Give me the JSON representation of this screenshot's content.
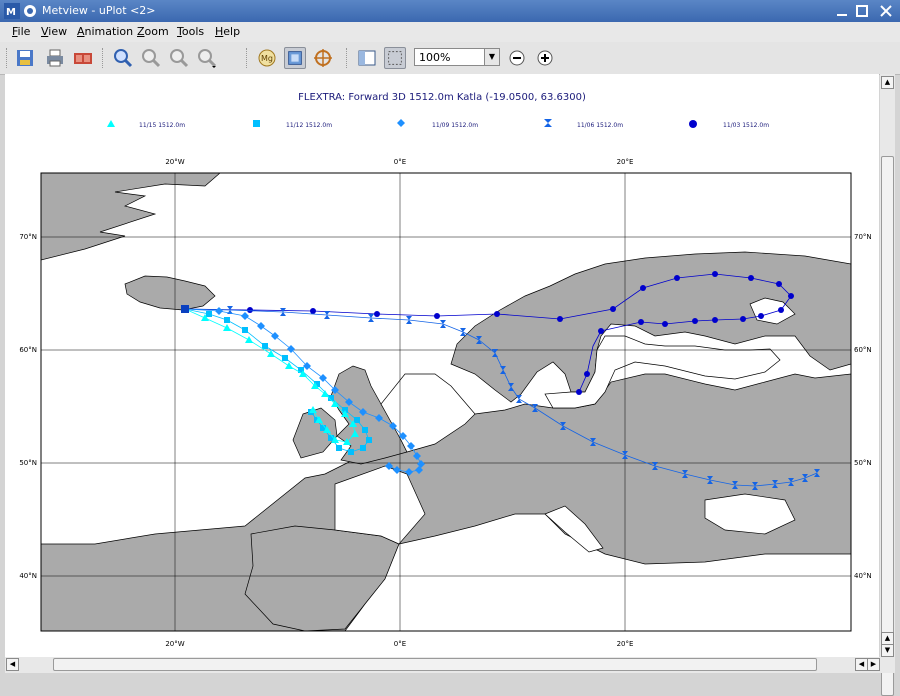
{
  "window": {
    "title": "Metview - uPlot <2>"
  },
  "menu": [
    {
      "label": "File",
      "key": "F",
      "rest": "ile"
    },
    {
      "label": "View",
      "key": "V",
      "rest": "iew"
    },
    {
      "label": "Animation",
      "key": "A",
      "rest": "nimation"
    },
    {
      "label": "Zoom",
      "key": "Z",
      "rest": "oom"
    },
    {
      "label": "Tools",
      "key": "T",
      "rest": "ools"
    },
    {
      "label": "Help",
      "key": "H",
      "rest": "elp"
    }
  ],
  "toolbar": {
    "zoom_value": "100%"
  },
  "plot": {
    "title": "FLEXTRA: Forward 3D 1512.0m Katla (-19.0500, 63.6300)",
    "legend": [
      {
        "label": "11/15 1512.0m",
        "marker": "triangle",
        "color": "#00ffff"
      },
      {
        "label": "11/12 1512.0m",
        "marker": "square",
        "color": "#00bfff"
      },
      {
        "label": "11/09 1512.0m",
        "marker": "diamond",
        "color": "#1e90ff"
      },
      {
        "label": "11/06 1512.0m",
        "marker": "hourglass",
        "color": "#1464e6"
      },
      {
        "label": "11/03 1512.0m",
        "marker": "circle",
        "color": "#0000cd"
      }
    ],
    "lon_labels": [
      "20°W",
      "0°E",
      "20°E"
    ],
    "lat_labels": [
      "70°N",
      "60°N",
      "50°N",
      "40°N"
    ]
  }
}
